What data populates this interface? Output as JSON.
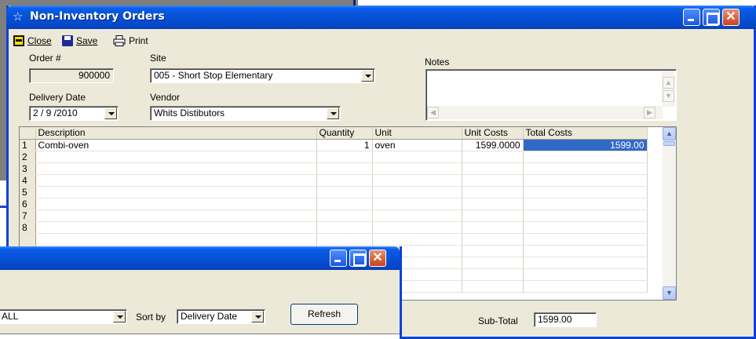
{
  "main_window": {
    "title": "Non-Inventory Orders",
    "toolbar": {
      "close": "Close",
      "save": "Save",
      "print": "Print"
    },
    "order": {
      "label": "Order #",
      "value": "900000"
    },
    "site": {
      "label": "Site",
      "value": "005 - Short Stop Elementary"
    },
    "notes": {
      "label": "Notes",
      "value": ""
    },
    "delivery_date": {
      "label": "Delivery Date",
      "value": "2 / 9 /2010"
    },
    "vendor": {
      "label": "Vendor",
      "value": "Whits Distibutors"
    },
    "grid": {
      "columns": [
        "Description",
        "Quantity",
        "Unit",
        "Unit Costs",
        "Total Costs"
      ],
      "rows": [
        {
          "n": "1",
          "description": "Combi-oven",
          "quantity": "1",
          "unit": "oven",
          "unit_cost": "1599.0000",
          "total": "1599.00"
        },
        {
          "n": "2"
        },
        {
          "n": "3"
        },
        {
          "n": "4"
        },
        {
          "n": "5"
        },
        {
          "n": "6"
        },
        {
          "n": "7"
        },
        {
          "n": "8"
        }
      ]
    },
    "subtotal": {
      "label": "Sub-Total",
      "value": "1599.00"
    }
  },
  "second_window": {
    "filter_value": "ALL",
    "sort_label": "Sort by",
    "sort_value": "Delivery Date",
    "refresh": "Refresh"
  }
}
